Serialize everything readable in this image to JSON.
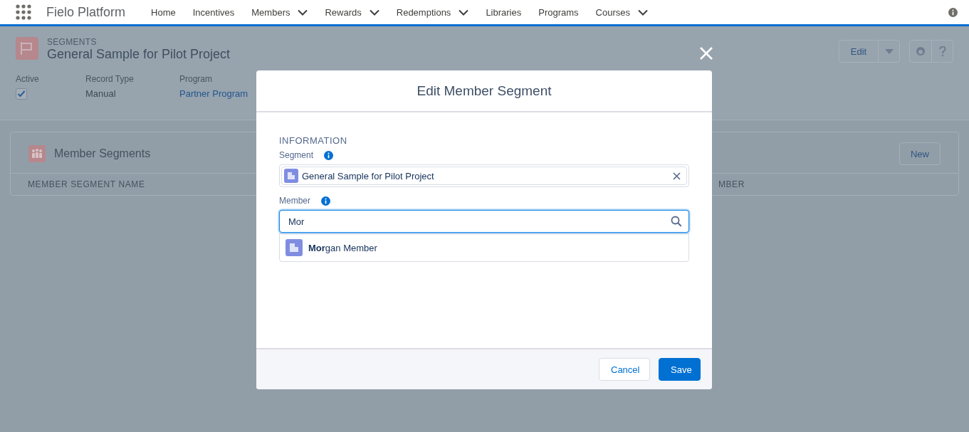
{
  "nav": {
    "app_name": "Fielo Platform",
    "items": [
      {
        "label": "Home",
        "dropdown": false
      },
      {
        "label": "Incentives",
        "dropdown": false
      },
      {
        "label": "Members",
        "dropdown": true
      },
      {
        "label": "Rewards",
        "dropdown": true
      },
      {
        "label": "Redemptions",
        "dropdown": true
      },
      {
        "label": "Libraries",
        "dropdown": false
      },
      {
        "label": "Programs",
        "dropdown": false
      },
      {
        "label": "Courses",
        "dropdown": true
      }
    ]
  },
  "record": {
    "object_label": "SEGMENTS",
    "title": "General Sample for Pilot Project",
    "edit_button": "Edit",
    "fields": [
      {
        "kind": "checkbox",
        "label": "Active",
        "checked": true
      },
      {
        "kind": "text",
        "label": "Record Type",
        "value": "Manual"
      },
      {
        "kind": "link",
        "label": "Program",
        "value": "Partner Program"
      }
    ]
  },
  "related_list": {
    "title": "Member Segments",
    "new_button": "New",
    "columns": [
      "MEMBER SEGMENT NAME",
      "MBER"
    ]
  },
  "modal": {
    "title": "Edit Member Segment",
    "section": "INFORMATION",
    "segment": {
      "label": "Segment",
      "value": "General Sample for Pilot Project"
    },
    "member": {
      "label": "Member",
      "value": "Mor",
      "results": [
        "**Mor**gan Member"
      ]
    },
    "buttons": [
      {
        "label": "Cancel",
        "kind": "neutral"
      },
      {
        "label": "Save",
        "kind": "brand"
      }
    ]
  }
}
